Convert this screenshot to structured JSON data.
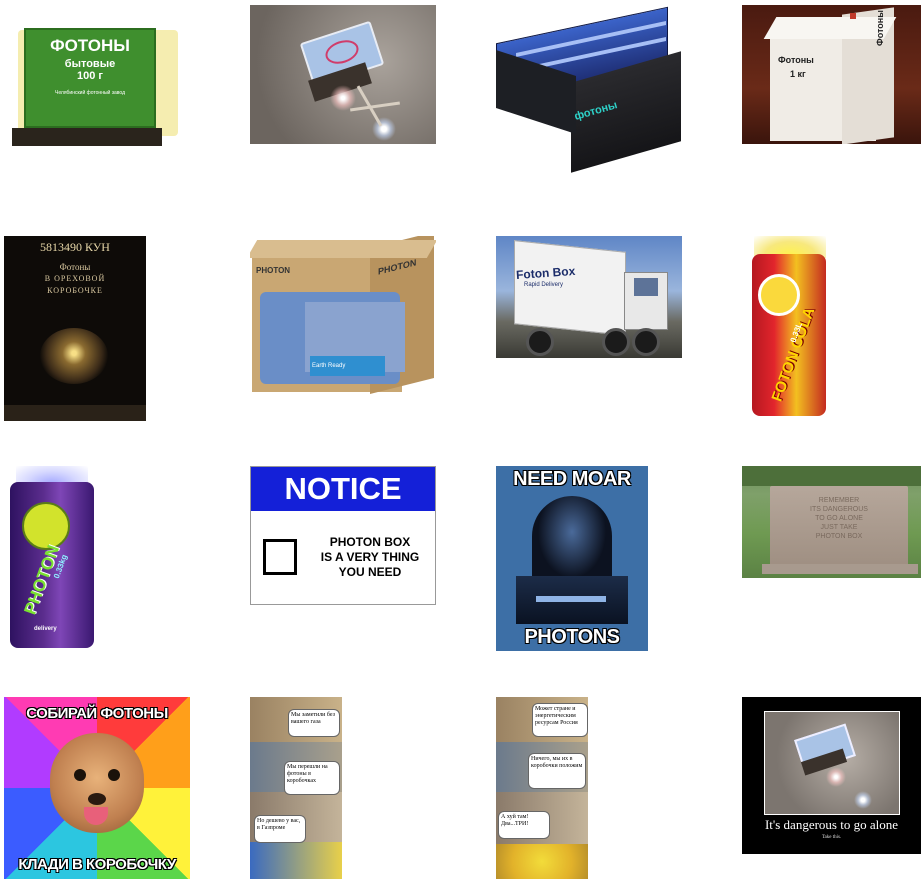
{
  "thumbs": {
    "t1": {
      "title": "ФОТОНЫ",
      "line2": "бытовые",
      "line3": "100 г",
      "footer": "Челябинский фотонный завод"
    },
    "t3": {
      "label": "фотоны"
    },
    "t4": {
      "line1": "Фотоны",
      "line2": "1 кг",
      "side": "Фотоны"
    },
    "t5": {
      "price": "5813490 КУН",
      "line1": "Фотоны",
      "line2": "В ОРЕХОВОЙ",
      "line3": "КОРОБОЧКЕ"
    },
    "t6": {
      "brand": "PHOTON",
      "brand2": "PHOTON",
      "panel": "Earth Ready"
    },
    "t7": {
      "line1": "Foton Box",
      "line2": "Rapid Delivery"
    },
    "t8": {
      "line1": "FOTON COLA",
      "line2": "0.33L"
    },
    "t9": {
      "line1": "PHOTON",
      "line2": "0.33kg",
      "brand": "delivery"
    },
    "t10": {
      "header": "NOTICE",
      "body1": "PHOTON BOX",
      "body2": "IS A VERY THING",
      "body3": "YOU NEED"
    },
    "t11": {
      "top": "NEED MOAR",
      "bottom": "PHOTONS"
    },
    "t12": {
      "l1": "REMEMBER",
      "l2": "ITS DANGEROUS",
      "l3": "TO GO ALONE",
      "l4": "JUST TAKE",
      "l5": "PHOTON BOX"
    },
    "t13": {
      "top": "СОБИРАЙ ФОТОНЫ",
      "bottom": "КЛАДИ В КОРОБОЧКУ"
    },
    "t14": {
      "b1": "Мы заметили без вашего газа",
      "b2": "Мы перешли на фотоны в коробочках",
      "b3": "Но дешево у вас, в Газпроме"
    },
    "t15": {
      "b1": "Может стране и энергетическим ресурсам Россия",
      "b2": "Ничего, мы их в коробочки положим",
      "b3": "А хуй там! Два...ТРИ!"
    },
    "t16": {
      "caption": "It's dangerous to go alone",
      "sub": "Take this."
    }
  },
  "colors": {
    "green": "#3f8f2e",
    "notice_blue": "#1420d8",
    "sw_blue": "#3d6fa6",
    "can_purple": "#5b2d8e"
  }
}
